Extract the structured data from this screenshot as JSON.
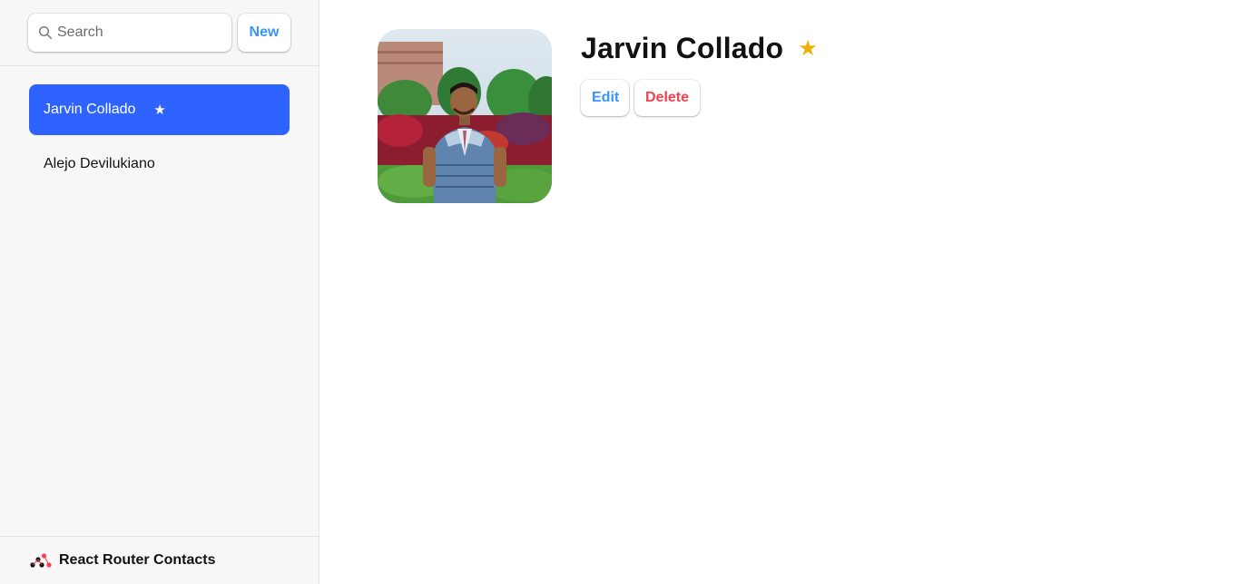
{
  "sidebar": {
    "search": {
      "placeholder": "Search",
      "value": "",
      "icon": "search-icon"
    },
    "new_label": "New",
    "contacts": [
      {
        "name": "Jarvin Collado",
        "favorite_mark": "★",
        "active": true
      },
      {
        "name": "Alejo Devilukiano",
        "favorite_mark": "",
        "active": false
      }
    ],
    "footer": {
      "logo": "react-router-logo-icon",
      "title": "React Router Contacts"
    }
  },
  "detail": {
    "name": "Jarvin Collado",
    "favorite_mark": "★",
    "avatar": "contact-photo",
    "edit_label": "Edit",
    "delete_label": "Delete"
  },
  "colors": {
    "accent": "#3992ff",
    "active_bg": "#2e63ff",
    "danger": "#f44250",
    "star": "#eeb004"
  }
}
